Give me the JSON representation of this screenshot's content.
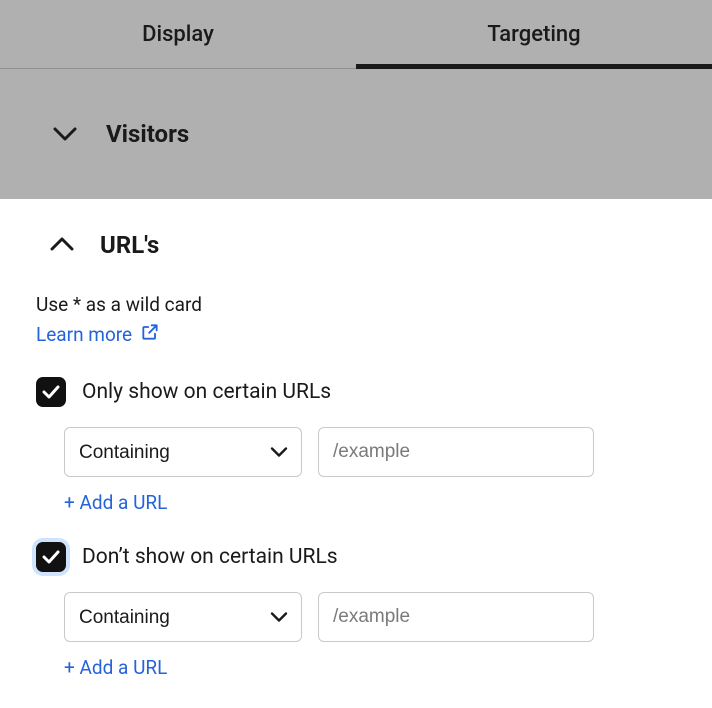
{
  "tabs": {
    "display": "Display",
    "targeting": "Targeting"
  },
  "sections": {
    "visitors": {
      "title": "Visitors"
    },
    "urls": {
      "title": "URL's",
      "helper": "Use * as a wild card",
      "learn_more": "Learn more",
      "only": {
        "label": "Only show on certain URLs",
        "mode": "Containing",
        "placeholder": "/example",
        "add": "+ Add a URL"
      },
      "dont": {
        "label": "Don’t show on certain URLs",
        "mode": "Containing",
        "placeholder": "/example",
        "add": "+ Add a URL"
      }
    }
  }
}
